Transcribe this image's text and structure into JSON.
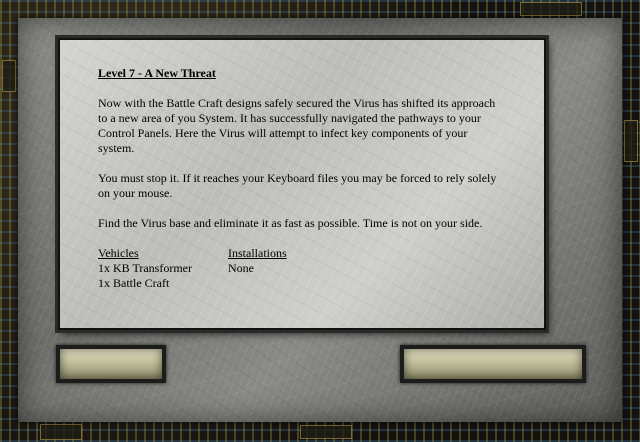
{
  "briefing": {
    "title": "Level 7 - A New Threat",
    "paragraphs": [
      "Now with the Battle Craft designs safely secured the Virus has shifted its approach to a new area of you System. It has successfully navigated the pathways to your Control Panels. Here the Virus will attempt to infect key components of your system.",
      "You must stop it. If it reaches your Keyboard files you may be forced to rely solely on your mouse.",
      "Find the Virus base and eliminate  it as fast as possible. Time is not on your side."
    ],
    "vehicles": {
      "heading": "Vehicles",
      "items": [
        "1x KB Transformer",
        "1x Battle Craft"
      ]
    },
    "installations": {
      "heading": "Installations",
      "items": [
        "None"
      ]
    }
  },
  "buttons": {
    "left_label": "",
    "right_label": ""
  },
  "colors": {
    "panel": "#c8c8c4",
    "frame": "#7a7a76",
    "button": "#d8d6b4",
    "text": "#000000"
  }
}
